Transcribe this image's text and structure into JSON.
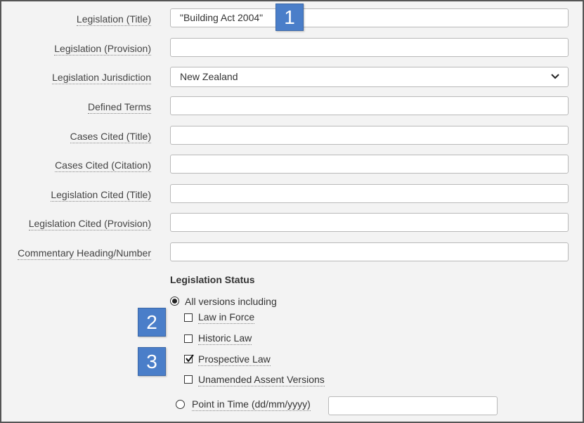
{
  "form": {
    "rows": [
      {
        "label": "Legislation (Title)",
        "value": "\"Building Act 2004\""
      },
      {
        "label": "Legislation (Provision)",
        "value": ""
      },
      {
        "label": "Legislation Jurisdiction",
        "value": "New Zealand"
      },
      {
        "label": "Defined Terms",
        "value": ""
      },
      {
        "label": "Cases Cited (Title)",
        "value": ""
      },
      {
        "label": "Cases Cited (Citation)",
        "value": ""
      },
      {
        "label": "Legislation Cited (Title)",
        "value": ""
      },
      {
        "label": "Legislation Cited (Provision)",
        "value": ""
      },
      {
        "label": "Commentary Heading/Number",
        "value": ""
      }
    ]
  },
  "status": {
    "title": "Legislation Status",
    "all_versions_label": "All versions including",
    "all_versions_selected": true,
    "options": [
      {
        "label": "Law in Force",
        "checked": false
      },
      {
        "label": "Historic Law",
        "checked": false
      },
      {
        "label": "Prospective Law",
        "checked": true
      },
      {
        "label": "Unamended Assent Versions",
        "checked": false
      }
    ],
    "point_in_time_label": "Point in Time (dd/mm/yyyy)",
    "point_in_time_selected": false,
    "point_in_time_value": ""
  },
  "badges": [
    "1",
    "2",
    "3"
  ],
  "colors": {
    "badge": "#4a7ec9",
    "background": "#f3f3f3"
  }
}
